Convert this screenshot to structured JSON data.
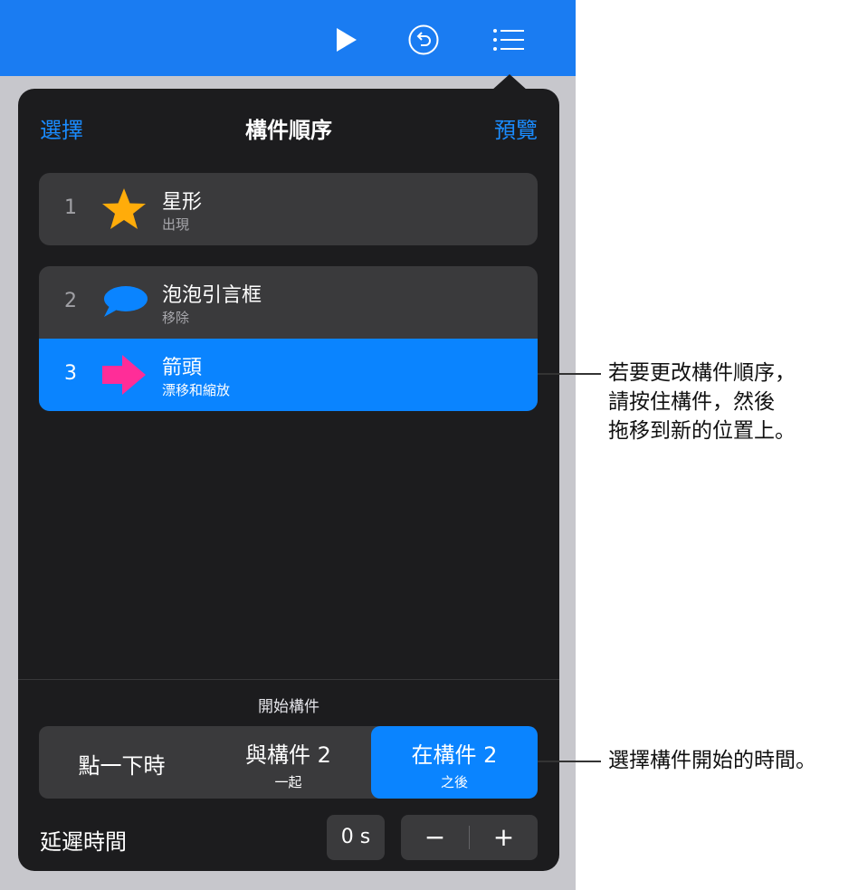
{
  "popover": {
    "left_button": "選擇",
    "title": "構件順序",
    "right_button": "預覽"
  },
  "builds": [
    {
      "number": "1",
      "title": "星形",
      "effect": "出現",
      "icon": "star-icon",
      "color": "#ffac0a"
    },
    {
      "number": "2",
      "title": "泡泡引言框",
      "effect": "移除",
      "icon": "speech-bubble-icon",
      "color": "#0a84ff"
    },
    {
      "number": "3",
      "title": "箭頭",
      "effect": "漂移和縮放",
      "icon": "arrow-right-icon",
      "color": "#ff2d98",
      "selected": true
    }
  ],
  "start": {
    "label": "開始構件",
    "options": [
      {
        "main": "點一下時",
        "sub": ""
      },
      {
        "main": "與構件 2",
        "sub": "一起"
      },
      {
        "main": "在構件 2",
        "sub": "之後",
        "selected": true
      }
    ]
  },
  "delay": {
    "label": "延遲時間",
    "value": "0 s",
    "decrement": "−",
    "increment": "+"
  },
  "callouts": {
    "reorder": [
      "若要更改構件順序，",
      "請按住構件，然後",
      "拖移到新的位置上。"
    ],
    "start": "選擇構件開始的時間。"
  },
  "colors": {
    "toolbar": "#1a7cf2",
    "accent": "#0a84ff",
    "panel": "#1c1c1e"
  }
}
